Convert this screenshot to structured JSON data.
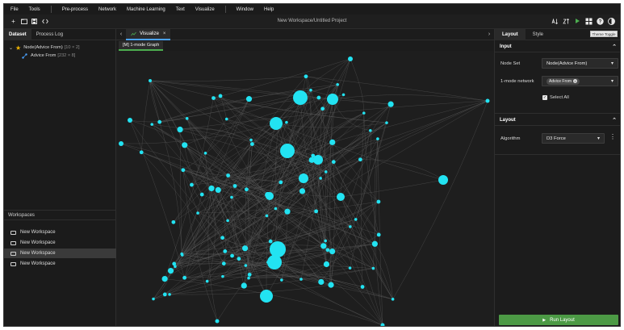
{
  "menu": [
    "File",
    "Tools",
    "Pre-process",
    "Network",
    "Machine Learning",
    "Text",
    "Visualize",
    "Window",
    "Help"
  ],
  "window_title": "New Workspace/Untitled Project",
  "toolbar_left_icons": [
    "plus-icon",
    "folder-icon",
    "save-icon",
    "code-icon"
  ],
  "toolbar_right_icons": [
    "sort-az-icon",
    "sort-za-icon",
    "play-icon",
    "grid-icon",
    "help-icon",
    "theme-toggle-icon"
  ],
  "tooltip": "Theme Toggle",
  "left_panel": {
    "tabs": [
      "Dataset",
      "Process Log"
    ],
    "tree": {
      "node": {
        "label": "Node(Advice From)",
        "count": "[10 × 2]"
      },
      "child": {
        "label": "Advice From",
        "count": "[232 × 8]"
      }
    },
    "workspaces_title": "Workspaces",
    "workspaces": [
      "New Workspace",
      "New Workspace",
      "New Workspace",
      "New Workspace"
    ]
  },
  "center": {
    "tab_label": "Visualize",
    "tab_close": "×",
    "subtab_label": "[M] 1-mode Graph",
    "nav_prev": "‹",
    "nav_next": "›"
  },
  "right_panel": {
    "tabs": [
      "Layout",
      "Style"
    ],
    "input_section": "Input",
    "node_set_label": "Node Set",
    "node_set_value": "Node(Advice From)",
    "network_label": "1-mode network",
    "network_chip": "Advice From",
    "select_all_label": "Select All",
    "layout_section": "Layout",
    "algorithm_label": "Algorithm",
    "algorithm_value": "D3 Force",
    "run_label": "Run Layout"
  },
  "colors": {
    "node": "#22e3f2",
    "edge": "#5a5a5a",
    "accent_blue": "#4aa3ff",
    "accent_green": "#4caf50",
    "run_button": "#4c9a45",
    "star": "#f0b400",
    "child_icon": "#4aa3ff"
  }
}
